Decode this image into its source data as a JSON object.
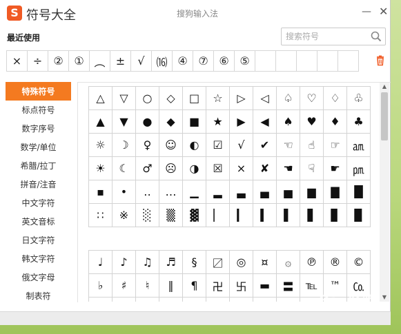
{
  "window": {
    "title": "符号大全",
    "subtitle": "搜狗输入法",
    "logo_letter": "S",
    "minimize_glyph": "—",
    "close_glyph": "✕"
  },
  "recent": {
    "label": "最近使用",
    "symbols": [
      "×",
      "÷",
      "②",
      "①",
      "︵",
      "±",
      "√",
      "⒃",
      "④",
      "⑦",
      "⑥",
      "⑤",
      "",
      "",
      "",
      "",
      ""
    ]
  },
  "search": {
    "placeholder": "搜索符号"
  },
  "categories": [
    "特殊符号",
    "标点符号",
    "数字序号",
    "数学/单位",
    "希腊/拉丁",
    "拼音/注音",
    "中文字符",
    "英文音标",
    "日文字符",
    "韩文字符",
    "俄文字母",
    "制表符"
  ],
  "active_category": "特殊符号",
  "grid1": [
    "△",
    "▽",
    "○",
    "◇",
    "□",
    "☆",
    "▷",
    "◁",
    "♤",
    "♡",
    "♢",
    "♧",
    "▲",
    "▼",
    "●",
    "◆",
    "■",
    "★",
    "▶",
    "◀",
    "♠",
    "♥",
    "♦",
    "♣",
    "☼",
    "☽",
    "♀",
    "☺",
    "◐",
    "☑",
    "√",
    "✔",
    "☜",
    "☝",
    "☞",
    "㏂",
    "☀",
    "☾",
    "♂",
    "☹",
    "◑",
    "☒",
    "×",
    "✘",
    "☚",
    "☟",
    "☛",
    "㏘",
    "▪",
    "•",
    "‥",
    "…",
    "▁",
    "▂",
    "▃",
    "▄",
    "▅",
    "▆",
    "▇",
    "█",
    "∷",
    "※",
    "░",
    "▒",
    "▓",
    "▏",
    "▎",
    "▍",
    "▌",
    "▋",
    "▊",
    "▉"
  ],
  "grid2": [
    "♩",
    "♪",
    "♫",
    "♬",
    "§",
    "〼",
    "◎",
    "¤",
    "۞",
    "℗",
    "®",
    "©",
    "♭",
    "♯",
    "♮",
    "‖",
    "¶",
    "卍",
    "卐",
    "▬",
    "〓",
    "℡",
    "™",
    "㏇",
    "",
    "",
    "",
    "",
    "",
    "",
    "",
    "",
    "",
    "",
    "",
    ""
  ],
  "watermark": "Bai 经验",
  "colors": {
    "accent": "#f47a20",
    "logo": "#f05a24",
    "trash": "#f05a24"
  }
}
